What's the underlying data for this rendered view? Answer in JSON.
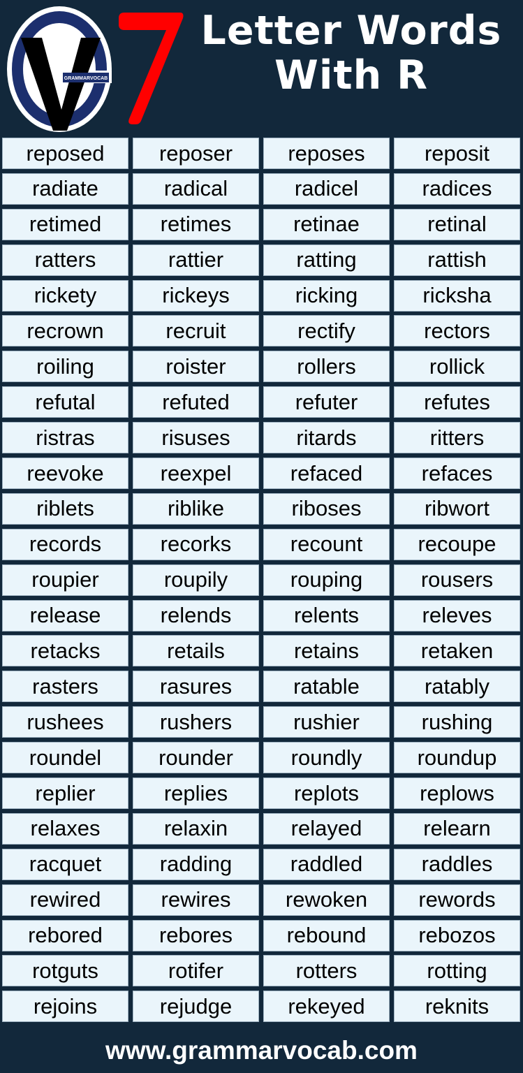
{
  "header": {
    "logo_text": "GRAMMARVOCAB",
    "number": "7",
    "title_line1": "Letter Words",
    "title_line2": "With R"
  },
  "colors": {
    "background": "#12283b",
    "cell_background": "#eaf5fb",
    "number_red": "#ff0000",
    "logo_blue": "#1c2f6e"
  },
  "words": [
    [
      "reposed",
      "reposer",
      "reposes",
      "reposit"
    ],
    [
      "radiate",
      "radical",
      "radicel",
      "radices"
    ],
    [
      "retimed",
      "retimes",
      "retinae",
      "retinal"
    ],
    [
      "ratters",
      "rattier",
      "ratting",
      "rattish"
    ],
    [
      "rickety",
      "rickeys",
      "ricking",
      "ricksha"
    ],
    [
      "recrown",
      "recruit",
      "rectify",
      "rectors"
    ],
    [
      "roiling",
      "roister",
      "rollers",
      "rollick"
    ],
    [
      "refutal",
      "refuted",
      "refuter",
      "refutes"
    ],
    [
      "ristras",
      "risuses",
      "ritards",
      "ritters"
    ],
    [
      "reevoke",
      "reexpel",
      "refaced",
      "refaces"
    ],
    [
      "riblets",
      "riblike",
      "riboses",
      "ribwort"
    ],
    [
      "records",
      "recorks",
      "recount",
      "recoupe"
    ],
    [
      "roupier",
      "roupily",
      "rouping",
      "rousers"
    ],
    [
      "release",
      "relends",
      "relents",
      "releves"
    ],
    [
      "retacks",
      "retails",
      "retains",
      "retaken"
    ],
    [
      "rasters",
      "rasures",
      "ratable",
      "ratably"
    ],
    [
      "rushees",
      "rushers",
      "rushier",
      "rushing"
    ],
    [
      "roundel",
      "rounder",
      "roundly",
      "roundup"
    ],
    [
      "replier",
      "replies",
      "replots",
      "replows"
    ],
    [
      "relaxes",
      "relaxin",
      "relayed",
      "relearn"
    ],
    [
      "racquet",
      "radding",
      "raddled",
      "raddles"
    ],
    [
      "rewired",
      "rewires",
      "rewoken",
      "rewords"
    ],
    [
      "rebored",
      "rebores",
      "rebound",
      "rebozos"
    ],
    [
      "rotguts",
      "rotifer",
      "rotters",
      "rotting"
    ],
    [
      "rejoins",
      "rejudge",
      "rekeyed",
      "reknits"
    ]
  ],
  "footer": {
    "url": "www.grammarvocab.com"
  }
}
